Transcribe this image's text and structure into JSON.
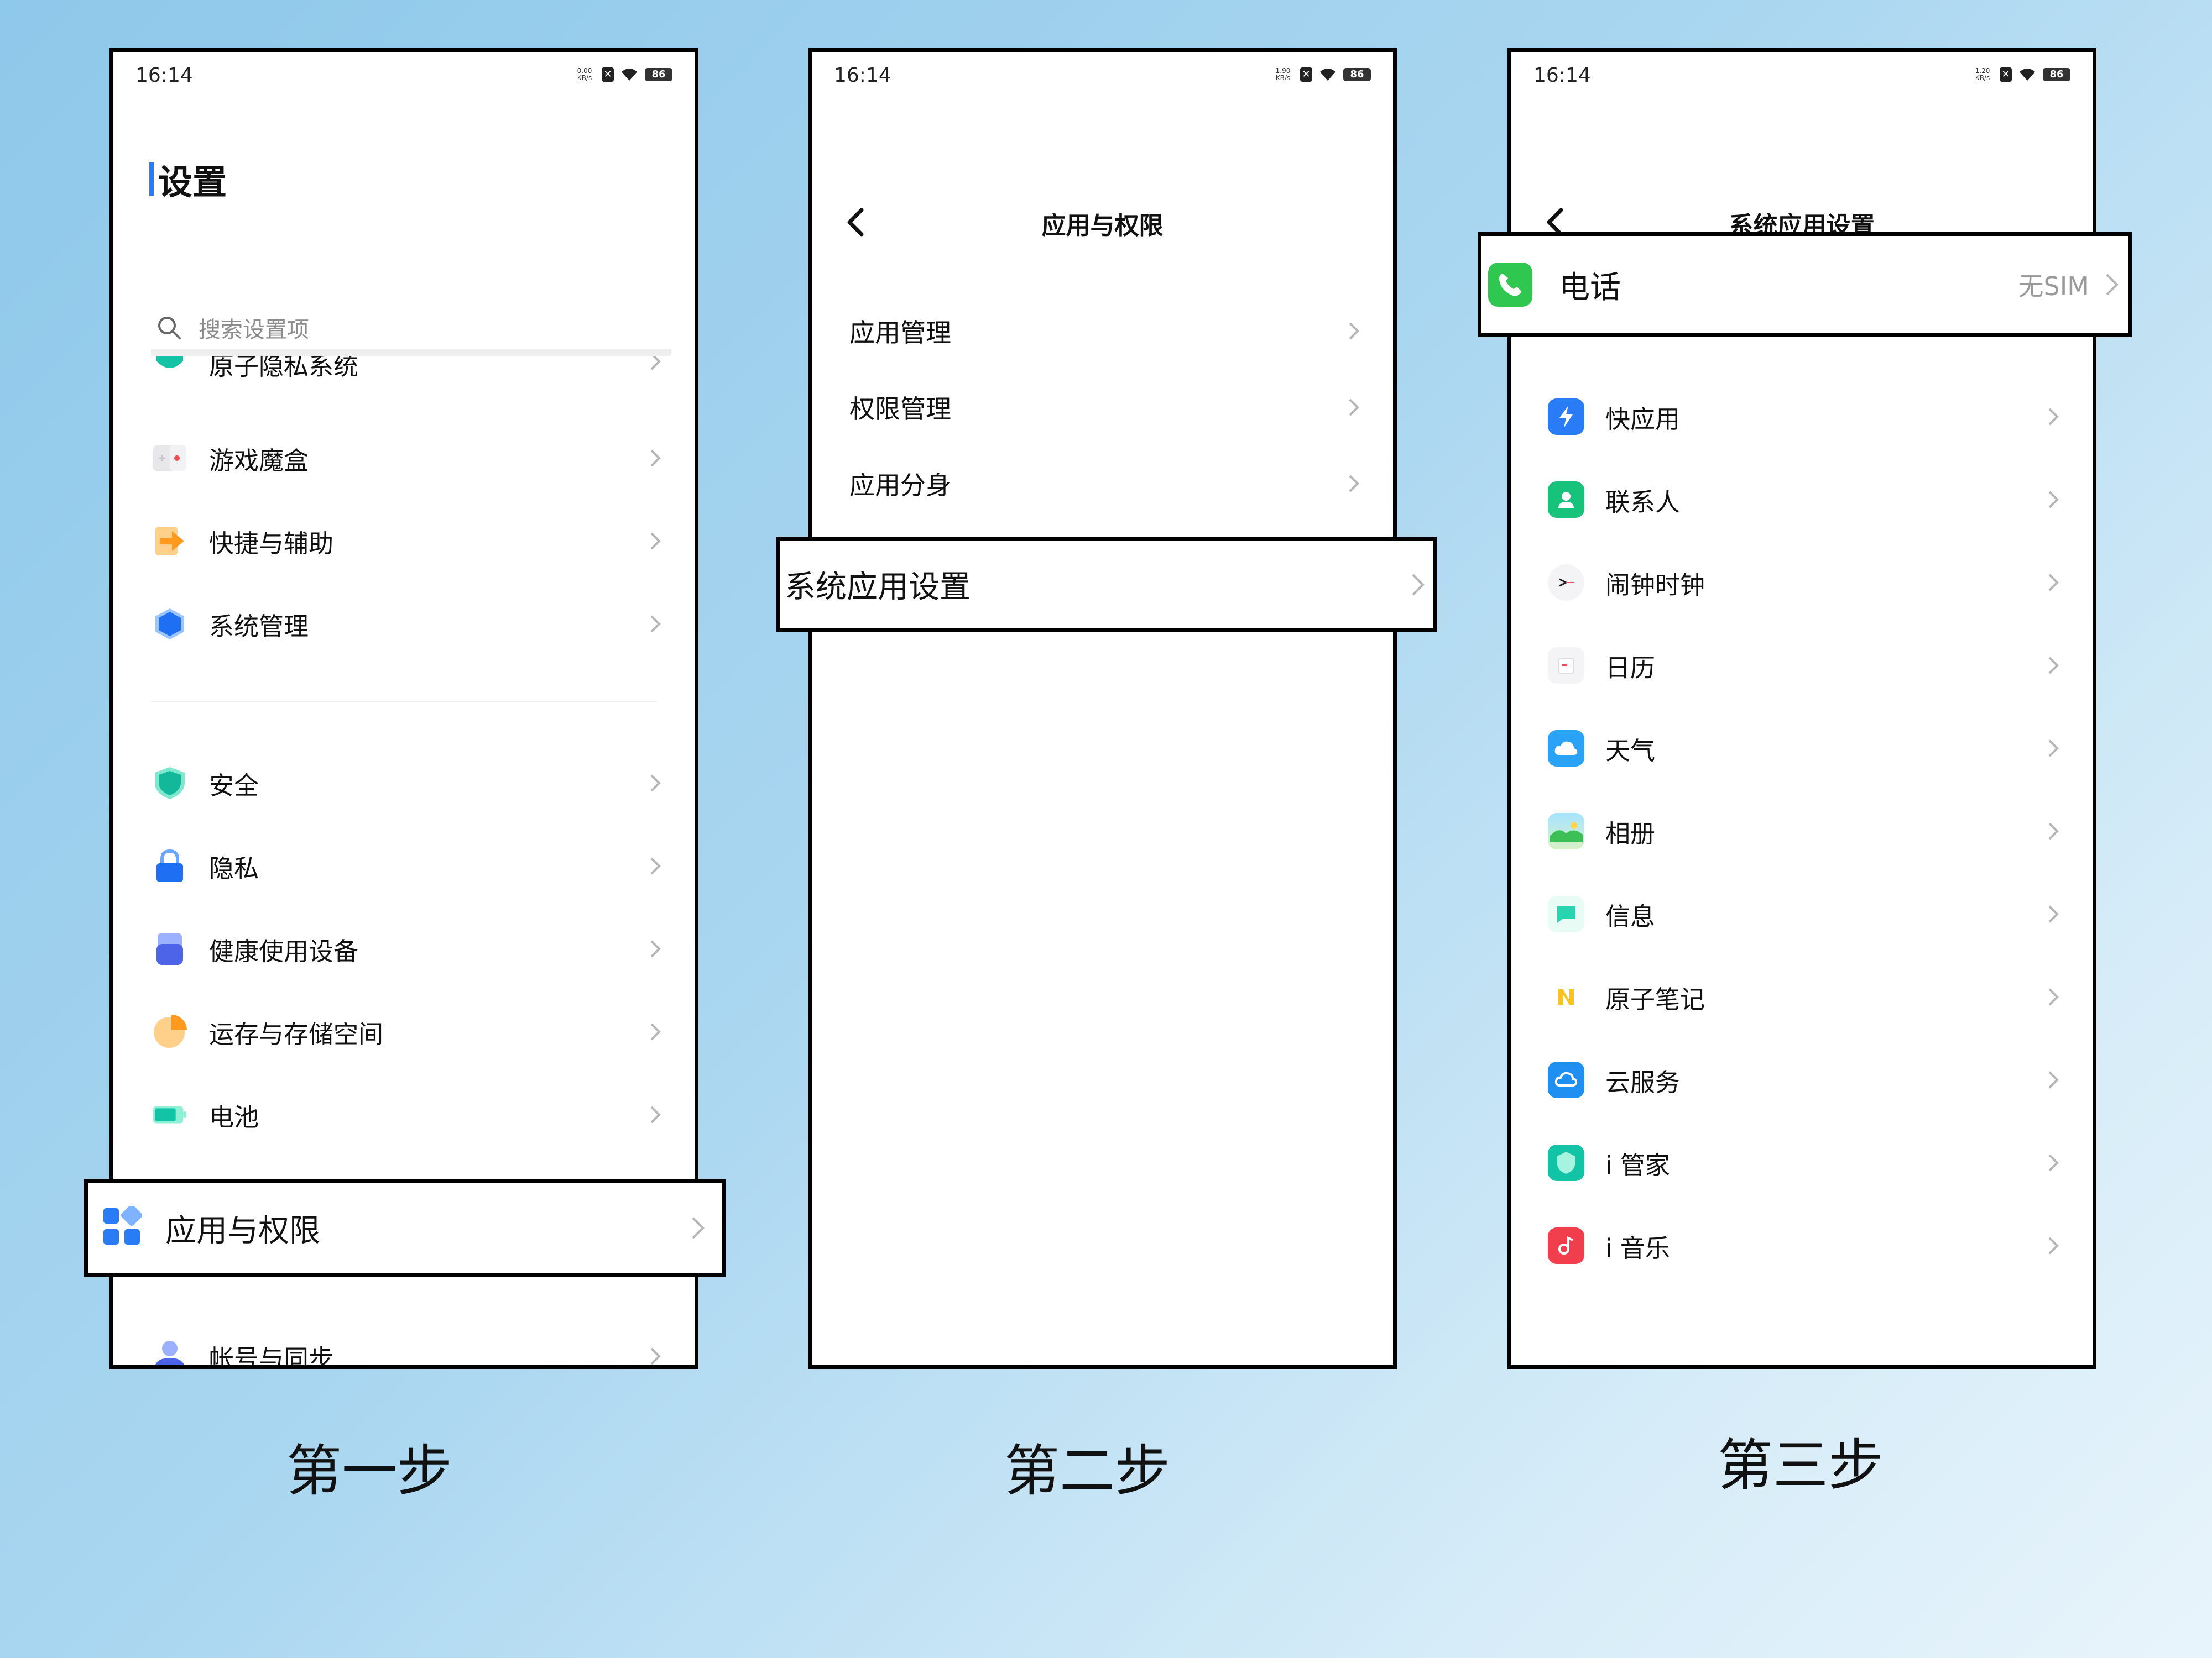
{
  "status": {
    "time": "16:14",
    "battery": "86",
    "speeds": [
      "0.00",
      "1.90",
      "1.20"
    ],
    "speed_unit": "KB/s",
    "nosim_glyph": "✕"
  },
  "step1": {
    "title": "设置",
    "search_placeholder": "搜索设置项",
    "items": [
      {
        "label": "原子隐私系统",
        "icon": "atom-privacy-icon"
      },
      {
        "label": "游戏魔盒",
        "icon": "game-box-icon"
      },
      {
        "label": "快捷与辅助",
        "icon": "shortcut-icon"
      },
      {
        "label": "系统管理",
        "icon": "system-manage-icon"
      },
      {
        "label": "安全",
        "icon": "shield-icon"
      },
      {
        "label": "隐私",
        "icon": "lock-icon"
      },
      {
        "label": "健康使用设备",
        "icon": "health-icon"
      },
      {
        "label": "运存与存储空间",
        "icon": "storage-icon"
      },
      {
        "label": "电池",
        "icon": "battery-icon"
      },
      {
        "label": "应用与权限",
        "icon": "apps-icon"
      },
      {
        "label": "帐号与同步",
        "icon": "account-icon"
      }
    ]
  },
  "step2": {
    "title": "应用与权限",
    "items": [
      {
        "label": "应用管理"
      },
      {
        "label": "权限管理"
      },
      {
        "label": "应用分身"
      },
      {
        "label": "系统应用设置"
      }
    ]
  },
  "step3": {
    "title": "系统应用设置",
    "phone": {
      "label": "电话",
      "value": "无SIM"
    },
    "items": [
      {
        "label": "快应用",
        "icon": "quick-app-icon"
      },
      {
        "label": "联系人",
        "icon": "contacts-icon"
      },
      {
        "label": "闹钟时钟",
        "icon": "clock-icon"
      },
      {
        "label": "日历",
        "icon": "calendar-icon"
      },
      {
        "label": "天气",
        "icon": "weather-icon"
      },
      {
        "label": "相册",
        "icon": "gallery-icon"
      },
      {
        "label": "信息",
        "icon": "message-icon"
      },
      {
        "label": "原子笔记",
        "icon": "notes-icon"
      },
      {
        "label": "云服务",
        "icon": "cloud-icon"
      },
      {
        "label": "i 管家",
        "icon": "i-manager-icon"
      },
      {
        "label": "i 音乐",
        "icon": "i-music-icon"
      }
    ]
  },
  "steps": [
    "第一步",
    "第二步",
    "第三步"
  ],
  "colors": {
    "accent": "#2a7cf6",
    "phone_green": "#2fc74f",
    "chevron": "#b5b5b5"
  }
}
